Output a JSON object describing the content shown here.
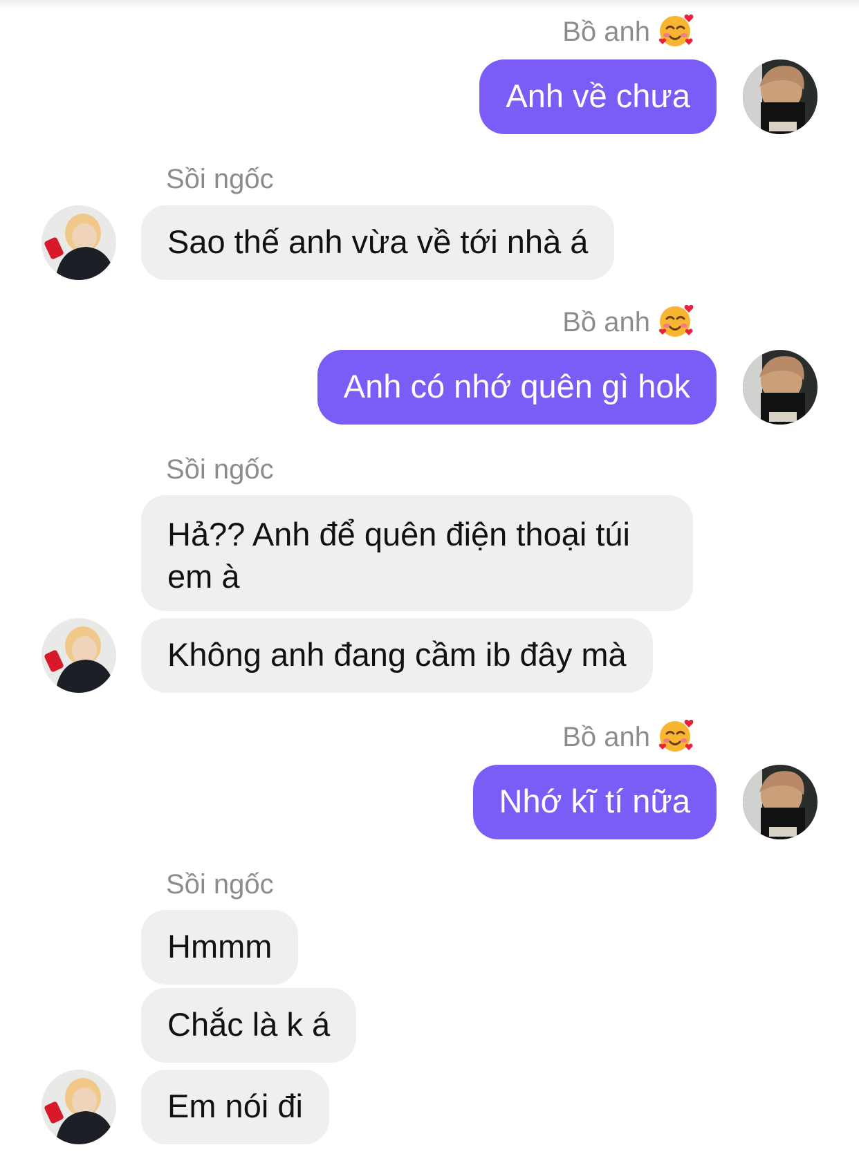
{
  "conversation": {
    "me_name": "Bồ anh",
    "other_name": "Sồi ngốc",
    "me_name_emoji": "smiling-face-with-hearts-icon",
    "colors": {
      "outgoing_bubble": "#7c5cf6",
      "incoming_bubble": "#efefef",
      "sender_name": "#8c8c8c"
    },
    "messages": [
      {
        "from": "me",
        "text": "Anh về chưa"
      },
      {
        "from": "other",
        "text": "Sao thế anh vừa về tới nhà á"
      },
      {
        "from": "me",
        "text": "Anh có nhớ quên gì hok"
      },
      {
        "from": "other",
        "text": "Hả?? Anh để quên điện thoại túi em à"
      },
      {
        "from": "other",
        "text": "Không anh đang cầm ib đây mà"
      },
      {
        "from": "me",
        "text": "Nhớ kĩ tí nữa"
      },
      {
        "from": "other",
        "text": "Hmmm"
      },
      {
        "from": "other",
        "text": "Chắc là k á"
      },
      {
        "from": "other",
        "text": "Em nói đi"
      }
    ]
  }
}
